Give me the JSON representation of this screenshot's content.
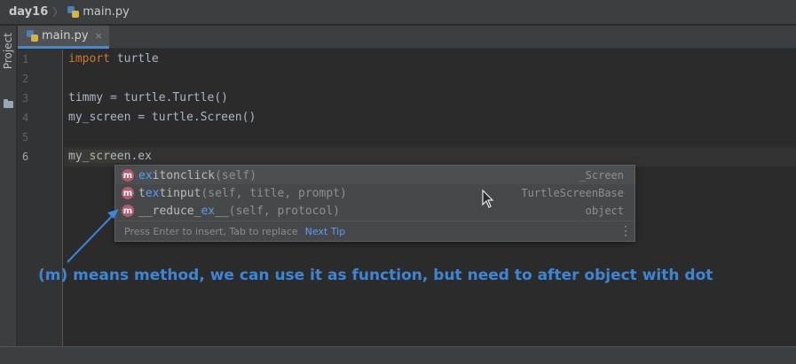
{
  "navbar": {
    "project": "day16",
    "file": "main.py"
  },
  "toolstrip": {
    "project_label": "Project"
  },
  "editor_tab": {
    "label": "main.py",
    "close": "×"
  },
  "editor": {
    "line_numbers": [
      "1",
      "2",
      "3",
      "4",
      "5",
      "6"
    ],
    "lines": {
      "l1_keyword": "import",
      "l1_rest": " turtle",
      "l3": "timmy = turtle.Turtle()",
      "l4": "my_screen = turtle.Screen()",
      "l6_highlight": "my_screen",
      "l6_rest": ".ex"
    }
  },
  "completion": {
    "items": [
      {
        "badge": "m",
        "pre": "",
        "match": "ex",
        "post": "itonclick",
        "sig": "(self)",
        "type": "_Screen"
      },
      {
        "badge": "m",
        "pre": "t",
        "match": "ex",
        "post": "tinput",
        "sig": "(self, title, prompt)",
        "type": "TurtleScreenBase"
      },
      {
        "badge": "m",
        "pre": "__reduce_",
        "match": "ex",
        "post": "__",
        "sig": "(self, protocol)",
        "type": "object"
      }
    ],
    "footer_text": "Press Enter to insert, Tab to replace",
    "footer_link": "Next Tip",
    "menu_icon": "vertical-dots-icon"
  },
  "annotation": {
    "text": "(m) means method, we can use it as function, but need to after object with dot",
    "color": "#3c86d8"
  },
  "colors": {
    "background": "#2b2b2b",
    "keyword": "#cc7832",
    "code": "#a9b7c6",
    "match": "#589df6",
    "method_badge": "#b55b6f"
  }
}
